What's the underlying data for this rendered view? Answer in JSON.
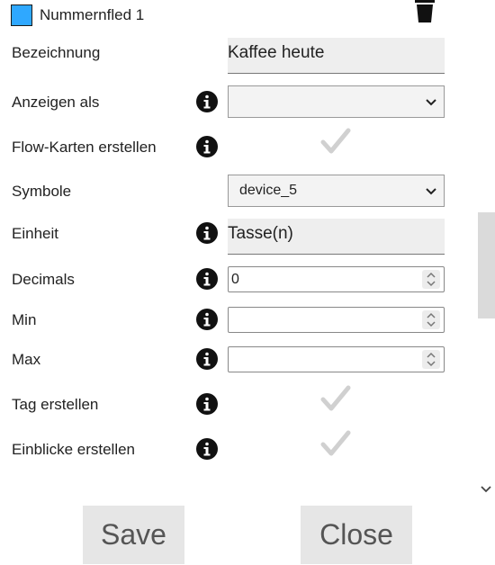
{
  "header": {
    "title": "Nummernfled 1",
    "swatch_color": "#2fa8ff",
    "delete_icon": "trash-icon"
  },
  "fields": {
    "bezeichnung": {
      "label": "Bezeichnung",
      "value": "Kaffee heute"
    },
    "anzeigen_als": {
      "label": "Anzeigen als",
      "value": ""
    },
    "flow_karten": {
      "label": "Flow-Karten erstellen",
      "checked": true
    },
    "symbole": {
      "label": "Symbole",
      "value": "device_5"
    },
    "einheit": {
      "label": "Einheit",
      "value": "Tasse(n)"
    },
    "decimals": {
      "label": "Decimals",
      "value": "0"
    },
    "min": {
      "label": "Min",
      "value": ""
    },
    "max": {
      "label": "Max",
      "value": ""
    },
    "tag": {
      "label": "Tag erstellen",
      "checked": true
    },
    "einblicke": {
      "label": "Einblicke erstellen",
      "checked": true
    }
  },
  "buttons": {
    "save": "Save",
    "close": "Close"
  },
  "colors": {
    "check": "#d0d0d0",
    "info": "#111111"
  }
}
